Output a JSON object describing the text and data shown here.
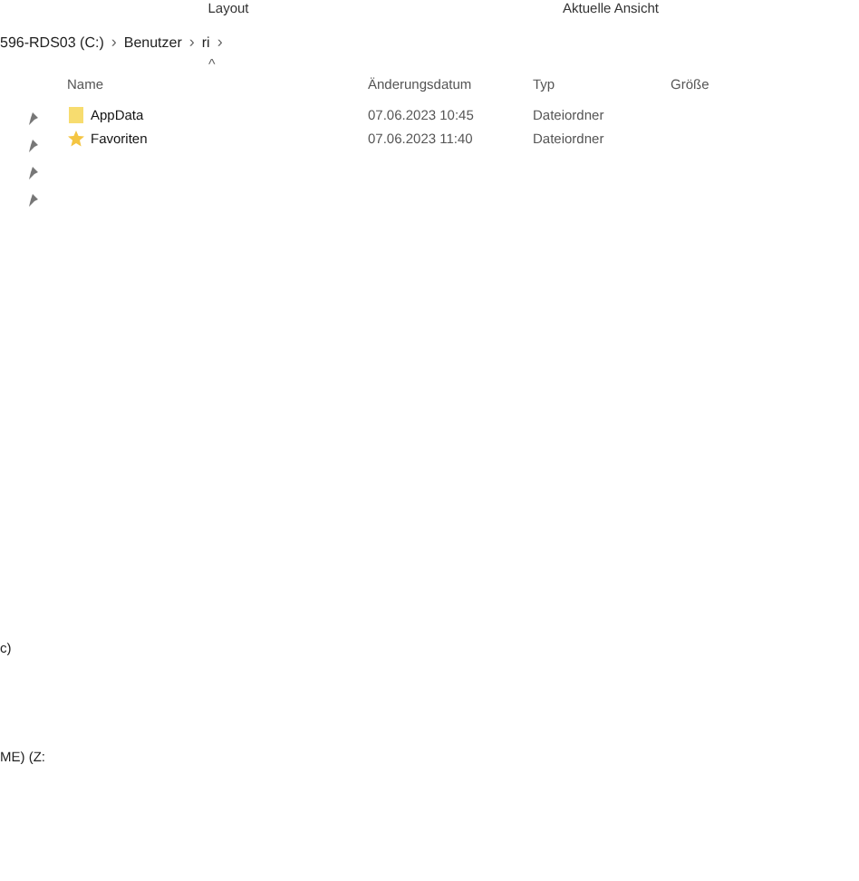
{
  "ribbon_groups": [
    "Layout",
    "Aktuelle Ansicht"
  ],
  "breadcrumb": [
    "596-RDS03 (C:)",
    "Benutzer",
    "ri"
  ],
  "breadcrumb_separator": "›",
  "sort_indicator": "^",
  "columns": [
    "Name",
    "Änderungsdatum",
    "Typ",
    "Größe"
  ],
  "rows": [
    {
      "kind": "folder",
      "name": "AppData",
      "date": "07.06.2023 10:45",
      "type": "Dateiordner"
    },
    {
      "kind": "favorites",
      "name": "Favoriten",
      "date": "07.06.2023 11:40",
      "type": "Dateiordner"
    }
  ],
  "pinned_count_items": [
    {
      "pinned": true
    },
    {
      "pinned": true
    },
    {
      "pinned": true
    },
    {
      "pinned": true
    }
  ],
  "sidebar_items": [
    "c)",
    "ME) (Z:"
  ]
}
